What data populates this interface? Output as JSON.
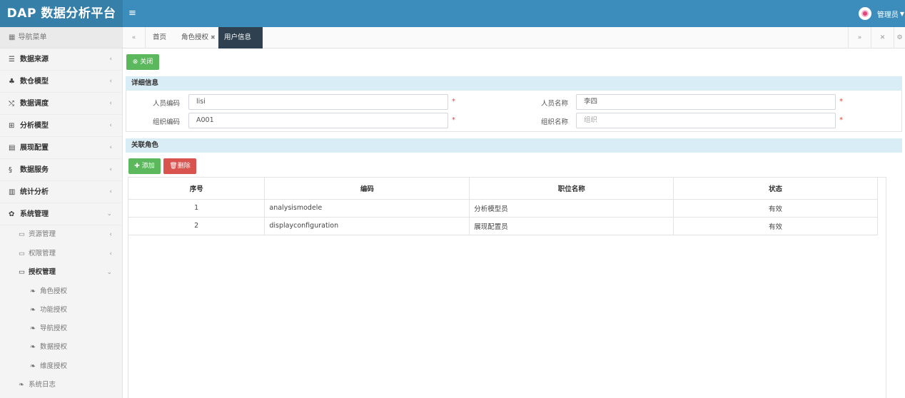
{
  "app": {
    "title": "DAP 数据分析平台",
    "menu_toggle": "≡",
    "user_name": "管理员"
  },
  "colors": {
    "header": "#3c8dbc",
    "logo_bg": "#367fa9",
    "active_tab": "#2f4050",
    "success": "#5cb85c",
    "danger": "#d9534f",
    "panel_head": "#d9edf7",
    "required": "#dd4b39"
  },
  "sidebar": {
    "title": "导航菜单",
    "items": [
      {
        "label": "数据来源",
        "icon": "database-icon"
      },
      {
        "label": "数仓模型",
        "icon": "cubes-icon"
      },
      {
        "label": "数据调度",
        "icon": "shuffle-icon"
      },
      {
        "label": "分析模型",
        "icon": "sitemap-icon"
      },
      {
        "label": "展现配置",
        "icon": "film-icon"
      },
      {
        "label": "数据服务",
        "icon": "service-icon"
      },
      {
        "label": "统计分析",
        "icon": "bar-chart-icon"
      },
      {
        "label": "系统管理",
        "icon": "gear-icon"
      }
    ],
    "sub_items": [
      {
        "label": "资源管理",
        "icon": "folder-icon"
      },
      {
        "label": "权限管理",
        "icon": "folder-icon"
      },
      {
        "label": "授权管理",
        "icon": "folder-icon"
      }
    ],
    "leaf_items": [
      {
        "label": "角色授权",
        "icon": "leaf-icon"
      },
      {
        "label": "功能授权",
        "icon": "leaf-icon"
      },
      {
        "label": "导航授权",
        "icon": "leaf-icon"
      },
      {
        "label": "数据授权",
        "icon": "leaf-icon"
      },
      {
        "label": "维度授权",
        "icon": "leaf-icon"
      }
    ],
    "bottom_item": {
      "label": "系统日志",
      "icon": "leaf-icon"
    }
  },
  "tabs": [
    {
      "label": "首页"
    },
    {
      "label": "角色授权"
    },
    {
      "label": "用户信息"
    }
  ],
  "toolbar": {
    "close_label": "关闭",
    "add_label": "添加",
    "delete_label": "删除"
  },
  "detail": {
    "heading": "详细信息",
    "person_code_label": "人员编码",
    "person_code_value": "lisi",
    "person_name_label": "人员名称",
    "person_name_value": "李四",
    "org_code_label": "组织编码",
    "org_code_value": "A001",
    "org_name_label": "组织名称",
    "org_name_placeholder": "组织",
    "required_mark": "*"
  },
  "roles": {
    "heading": "关联角色",
    "columns": [
      "序号",
      "编码",
      "职位名称",
      "状态"
    ],
    "rows": [
      [
        "1",
        "analysismodele",
        "分析模型员",
        "有效"
      ],
      [
        "2",
        "displayconfiguration",
        "展现配置员",
        "有效"
      ]
    ]
  }
}
